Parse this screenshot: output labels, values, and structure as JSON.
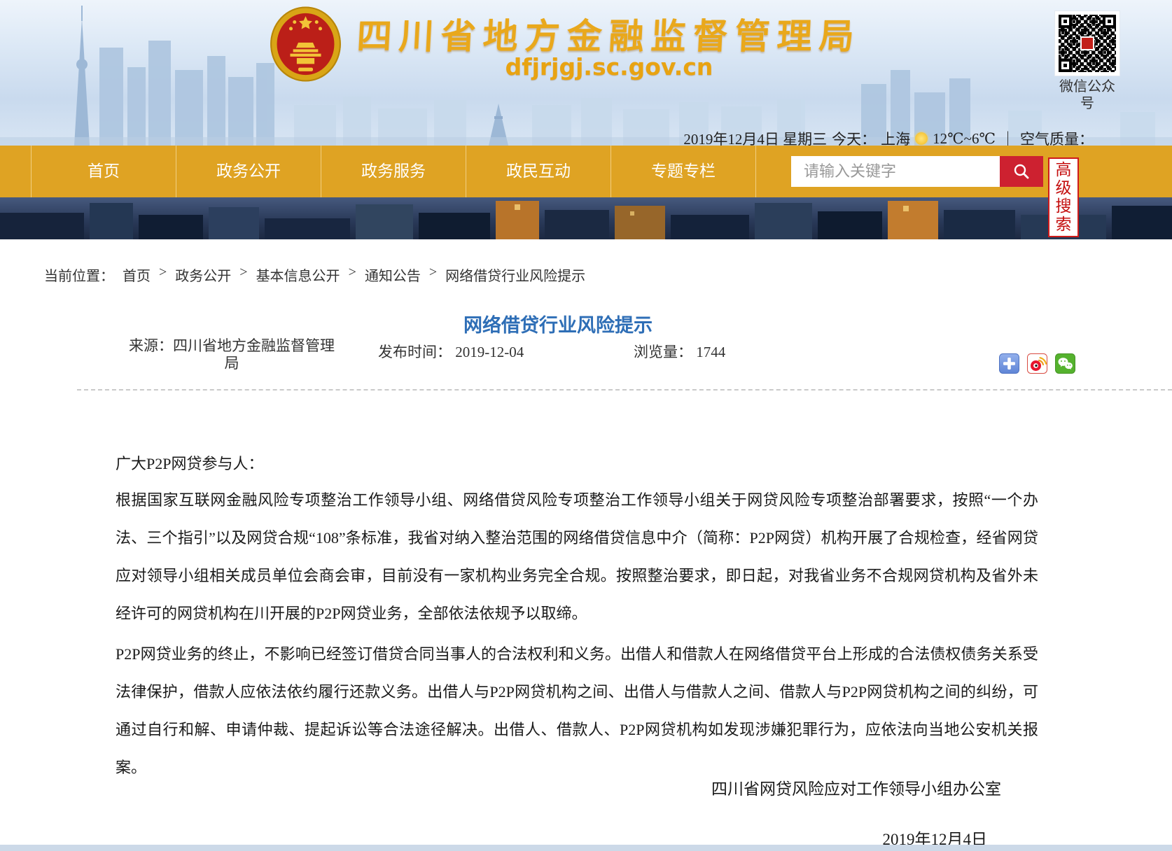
{
  "header": {
    "site_name": "四川省地方金融监督管理局",
    "site_url": "dfjrjgj.sc.gov.cn",
    "qr_label": "微信公众号",
    "info": {
      "date": "2019年12月4日 星期三",
      "today_label": "今天：",
      "city": "上海",
      "temp": "12℃~6℃",
      "divider": "｜",
      "air_label": "空气质量："
    }
  },
  "nav": {
    "items": [
      "首页",
      "政务公开",
      "政务服务",
      "政民互动",
      "专题专栏"
    ],
    "search_placeholder": "请输入关键字",
    "advanced_search": "高级搜索"
  },
  "breadcrumb": {
    "label": "当前位置：",
    "separator": ">",
    "items": [
      "首页",
      "政务公开",
      "基本信息公开",
      "通知公告",
      "网络借贷行业风险提示"
    ]
  },
  "article": {
    "title": "网络借贷行业风险提示",
    "source_label": "来源：",
    "source": "四川省地方金融监督管理局",
    "publish_label": "发布时间：",
    "publish_date": "2019-12-04",
    "views_label": "浏览量：",
    "views": "1744",
    "share_icons": [
      "share-plus-icon",
      "weibo-icon",
      "wechat-icon"
    ],
    "salutation": "广大P2P网贷参与人：",
    "paragraphs": [
      "根据国家互联网金融风险专项整治工作领导小组、网络借贷风险专项整治工作领导小组关于网贷风险专项整治部署要求，按照“一个办法、三个指引”以及网贷合规“108”条标准，我省对纳入整治范围的网络借贷信息中介（简称：P2P网贷）机构开展了合规检查，经省网贷应对领导小组相关成员单位会商会审，目前没有一家机构业务完全合规。按照整治要求，即日起，对我省业务不合规网贷机构及省外未经许可的网贷机构在川开展的P2P网贷业务，全部依法依规予以取缔。",
      "P2P网贷业务的终止，不影响已经签订借贷合同当事人的合法权利和义务。出借人和借款人在网络借贷平台上形成的合法债权债务关系受法律保护，借款人应依法依约履行还款义务。出借人与P2P网贷机构之间、出借人与借款人之间、借款人与P2P网贷机构之间的纠纷，可通过自行和解、申请仲裁、提起诉讼等合法途径解决。出借人、借款人、P2P网贷机构如发现涉嫌犯罪行为，应依法向当地公安机关报案。"
    ],
    "signature": "四川省网贷风险应对工作领导小组办公室",
    "date": "2019年12月4日"
  },
  "colors": {
    "nav_gold": "#dfa323",
    "search_red": "#cd2130",
    "advanced_red": "#c40f0f",
    "title_blue": "#2e6eb6",
    "share_blue": "#7b9ce3",
    "weibo_red": "#e6162d",
    "wechat_green": "#55b22e",
    "text": "#333333"
  }
}
